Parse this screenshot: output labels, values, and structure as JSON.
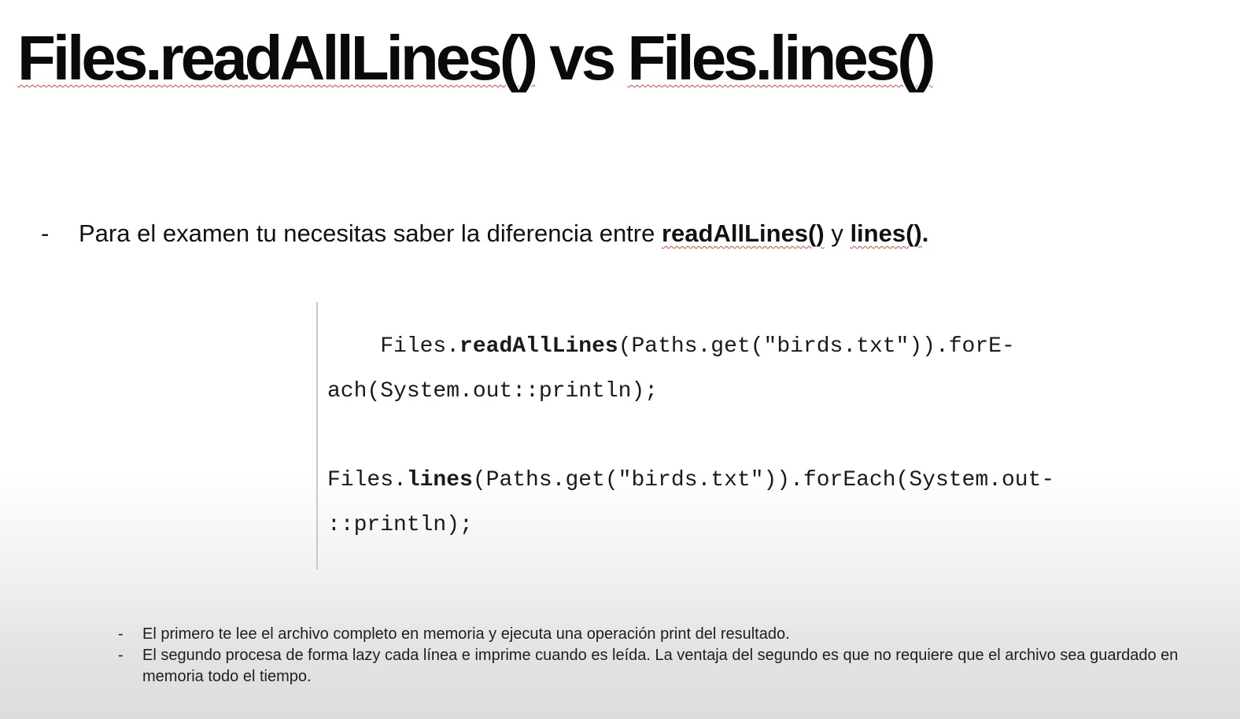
{
  "slide": {
    "title": {
      "part1": "Files.readAllLines()",
      "part2": " vs ",
      "part3": "Files.lines()"
    },
    "bullet": {
      "dash": "-",
      "text": "Para el examen tu necesitas saber la diferencia entre ",
      "method1": "readAllLines()",
      "connector": " y ",
      "method2": "lines()",
      "end": "."
    },
    "code": {
      "block1": {
        "indent": "    ",
        "prefix": "Files.",
        "method": "readAllLines",
        "suffix_line1": "(Paths.get(\"birds.txt\")).forE-",
        "line2": "ach(System.out::println);"
      },
      "block2": {
        "prefix": "Files.",
        "method": "lines",
        "suffix_line1": "(Paths.get(\"birds.txt\")).forEach(System.out-",
        "line2": "::println);"
      }
    },
    "notes": [
      {
        "dash": "-",
        "text": "El primero te lee el archivo completo en memoria y ejecuta una operación print del resultado."
      },
      {
        "dash": "-",
        "text": "El segundo procesa de forma lazy cada línea e imprime cuando es leída. La ventaja del segundo es que no requiere que el archivo sea guardado en memoria todo el tiempo."
      }
    ]
  }
}
